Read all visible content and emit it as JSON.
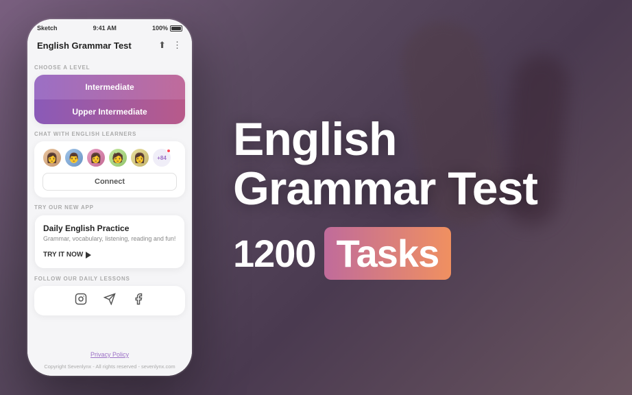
{
  "background": {
    "color": "#6b5a6e"
  },
  "phone": {
    "status_bar": {
      "carrier": "Sketch",
      "time": "9:41 AM",
      "battery": "100%"
    },
    "app_header": {
      "title": "English Grammar Test",
      "share_icon": "⬆",
      "more_icon": "⋮"
    },
    "choose_level": {
      "label": "CHOOSE A LEVEL",
      "levels": [
        {
          "id": "intermediate",
          "label": "Intermediate"
        },
        {
          "id": "upper-intermediate",
          "label": "Upper Intermediate"
        }
      ]
    },
    "chat_section": {
      "label": "CHAT WITH ENGLISH LEARNERS",
      "avatar_count": "+84",
      "connect_label": "Connect"
    },
    "new_app_section": {
      "label": "TRY OUR NEW APP",
      "title": "Daily English Practice",
      "description": "Grammar, vocabulary, listening, reading and fun!",
      "cta_label": "TRY IT NOW"
    },
    "social_section": {
      "label": "FOLLOW OUR DAILY LESSONS"
    },
    "footer": {
      "privacy_label": "Privacy Policy",
      "copyright": "Copyright Sevenlynx - All rights reserved - sevenlynx.com"
    }
  },
  "right_panel": {
    "title_line1": "English",
    "title_line2": "Grammar Test",
    "tasks_number": "1200",
    "tasks_label": "Tasks"
  }
}
